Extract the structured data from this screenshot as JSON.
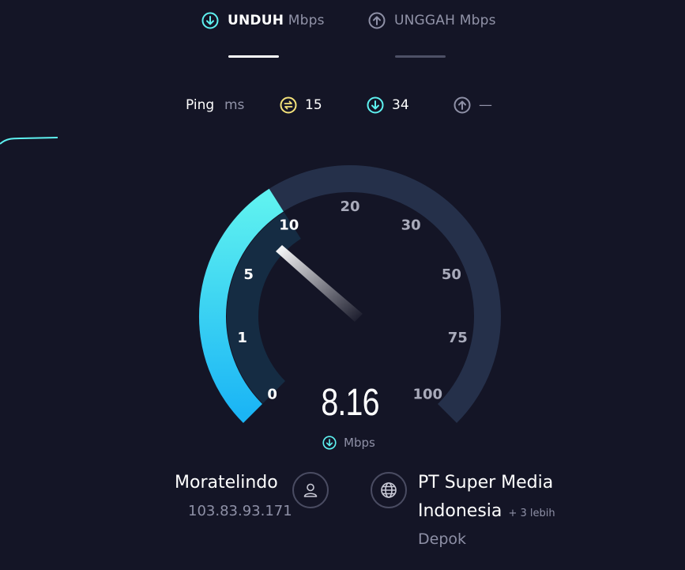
{
  "tabs": [
    {
      "label": "UNDUH",
      "unit": "Mbps",
      "active": true,
      "icon": "download-icon"
    },
    {
      "label": "UNGGAH",
      "unit": "Mbps",
      "active": false,
      "icon": "upload-icon"
    }
  ],
  "ping": {
    "label": "Ping",
    "unit": "ms",
    "idle": "15",
    "download": "34",
    "upload": "—"
  },
  "gauge": {
    "ticks": [
      "0",
      "1",
      "5",
      "10",
      "20",
      "30",
      "50",
      "75",
      "100"
    ],
    "current_speed": "8.16",
    "unit": "Mbps",
    "fill_tick_fraction": 0.38
  },
  "provider": {
    "name": "Moratelindo",
    "ip": "103.83.93.171"
  },
  "server": {
    "name_line1": "PT Super Media",
    "name_line2": "Indonesia",
    "more": "+ 3 lebih",
    "location": "Depok"
  },
  "colors": {
    "background": "#141526",
    "accent_cyan": "#5ef1f0",
    "accent_blue": "#1bb5f5",
    "gauge_track": "#25304a",
    "ping_idle": "#f4e27a",
    "ping_down": "#5ef1f0",
    "ping_up": "#8e90a6"
  }
}
